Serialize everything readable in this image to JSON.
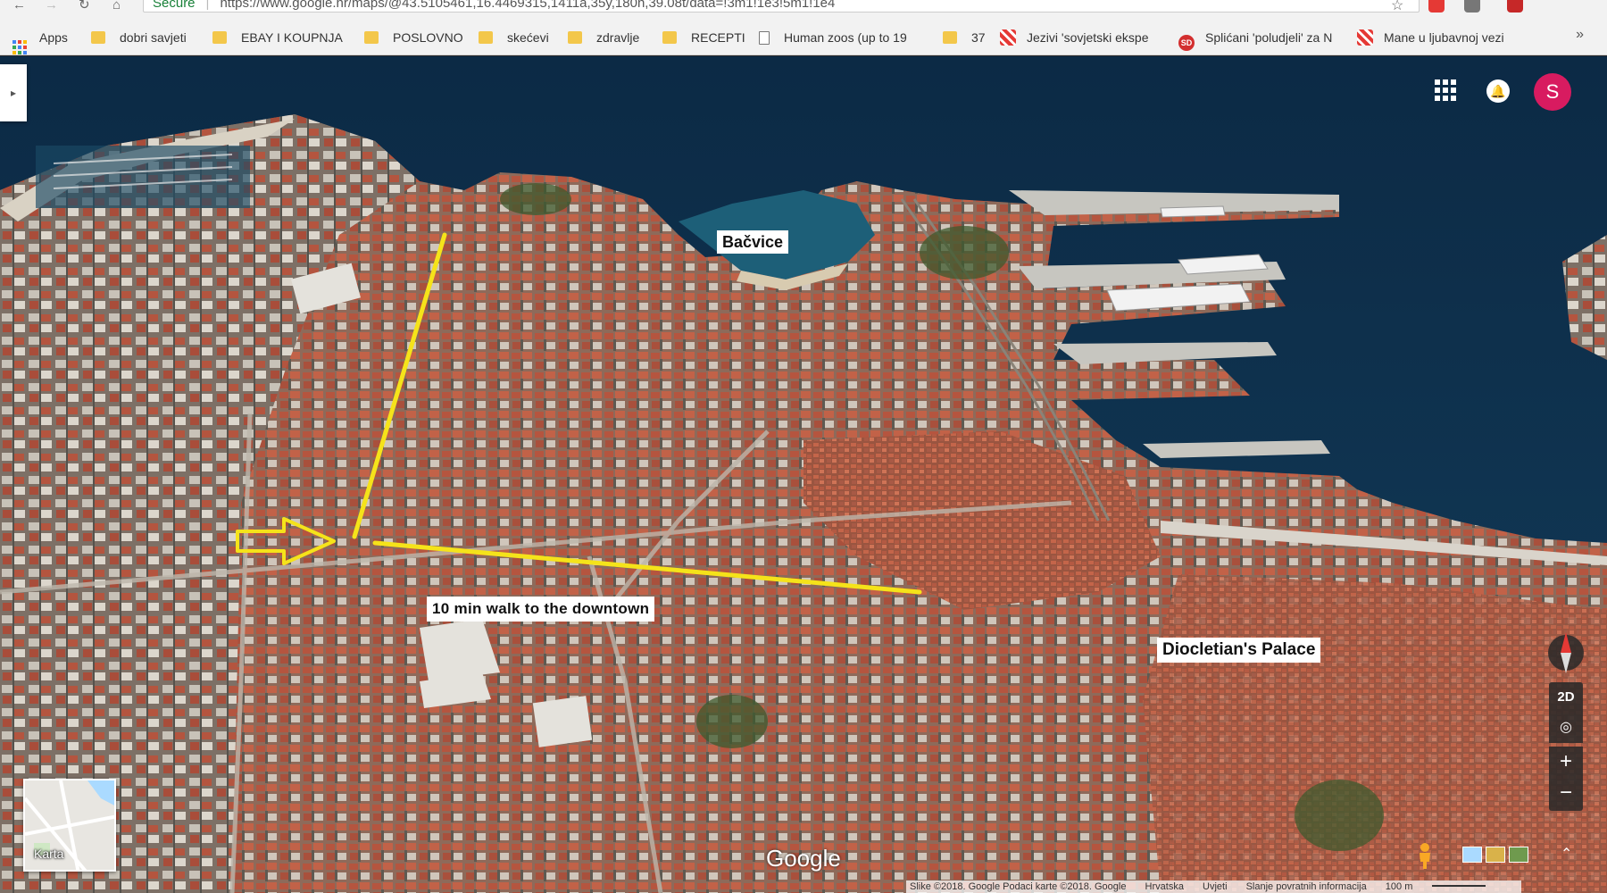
{
  "browser": {
    "secure_label": "Secure",
    "url": "https://www.google.hr/maps/@43.5105461,16.4469315,1411a,35y,180h,39.08t/data=!3m1!1e3!5m1!1e4"
  },
  "bookmarks": {
    "items": [
      {
        "label": "Apps",
        "icon": "apps-grid-icon"
      },
      {
        "label": "dobri savjeti",
        "icon": "folder-icon"
      },
      {
        "label": "EBAY I KOUPNJA",
        "icon": "folder-icon"
      },
      {
        "label": "POSLOVNO",
        "icon": "folder-icon"
      },
      {
        "label": "skećevi",
        "icon": "folder-icon"
      },
      {
        "label": "zdravlje",
        "icon": "folder-icon"
      },
      {
        "label": "RECEPTI",
        "icon": "folder-icon"
      },
      {
        "label": "Human zoos (up to 19",
        "icon": "document-icon"
      },
      {
        "label": "37",
        "icon": "folder-icon"
      },
      {
        "label": "Jezivi 'sovjetski ekspe",
        "icon": "site-favicon"
      },
      {
        "label": "Splićani 'poludjeli' za N",
        "icon": "sd-favicon"
      },
      {
        "label": "Mane u ljubavnoj vezi",
        "icon": "site-favicon"
      }
    ],
    "more": "»"
  },
  "map": {
    "labels": {
      "bacvice": "Bačvice",
      "walk": "10 min walk to the downtown",
      "palace": "Diocletian's Palace"
    },
    "annotation_color": "#f5e31a",
    "avatar_letter": "S",
    "karta_label": "Karta",
    "google_logo": "Google",
    "controls": {
      "mode": "2D",
      "zoom_in": "+",
      "zoom_out": "−",
      "expand": "⌃"
    },
    "attribution": {
      "imagery": "Slike ©2018. Google Podaci karte ©2018. Google",
      "country": "Hrvatska",
      "terms": "Uvjeti",
      "feedback": "Slanje povratnih informacija",
      "scale": "100 m"
    }
  }
}
